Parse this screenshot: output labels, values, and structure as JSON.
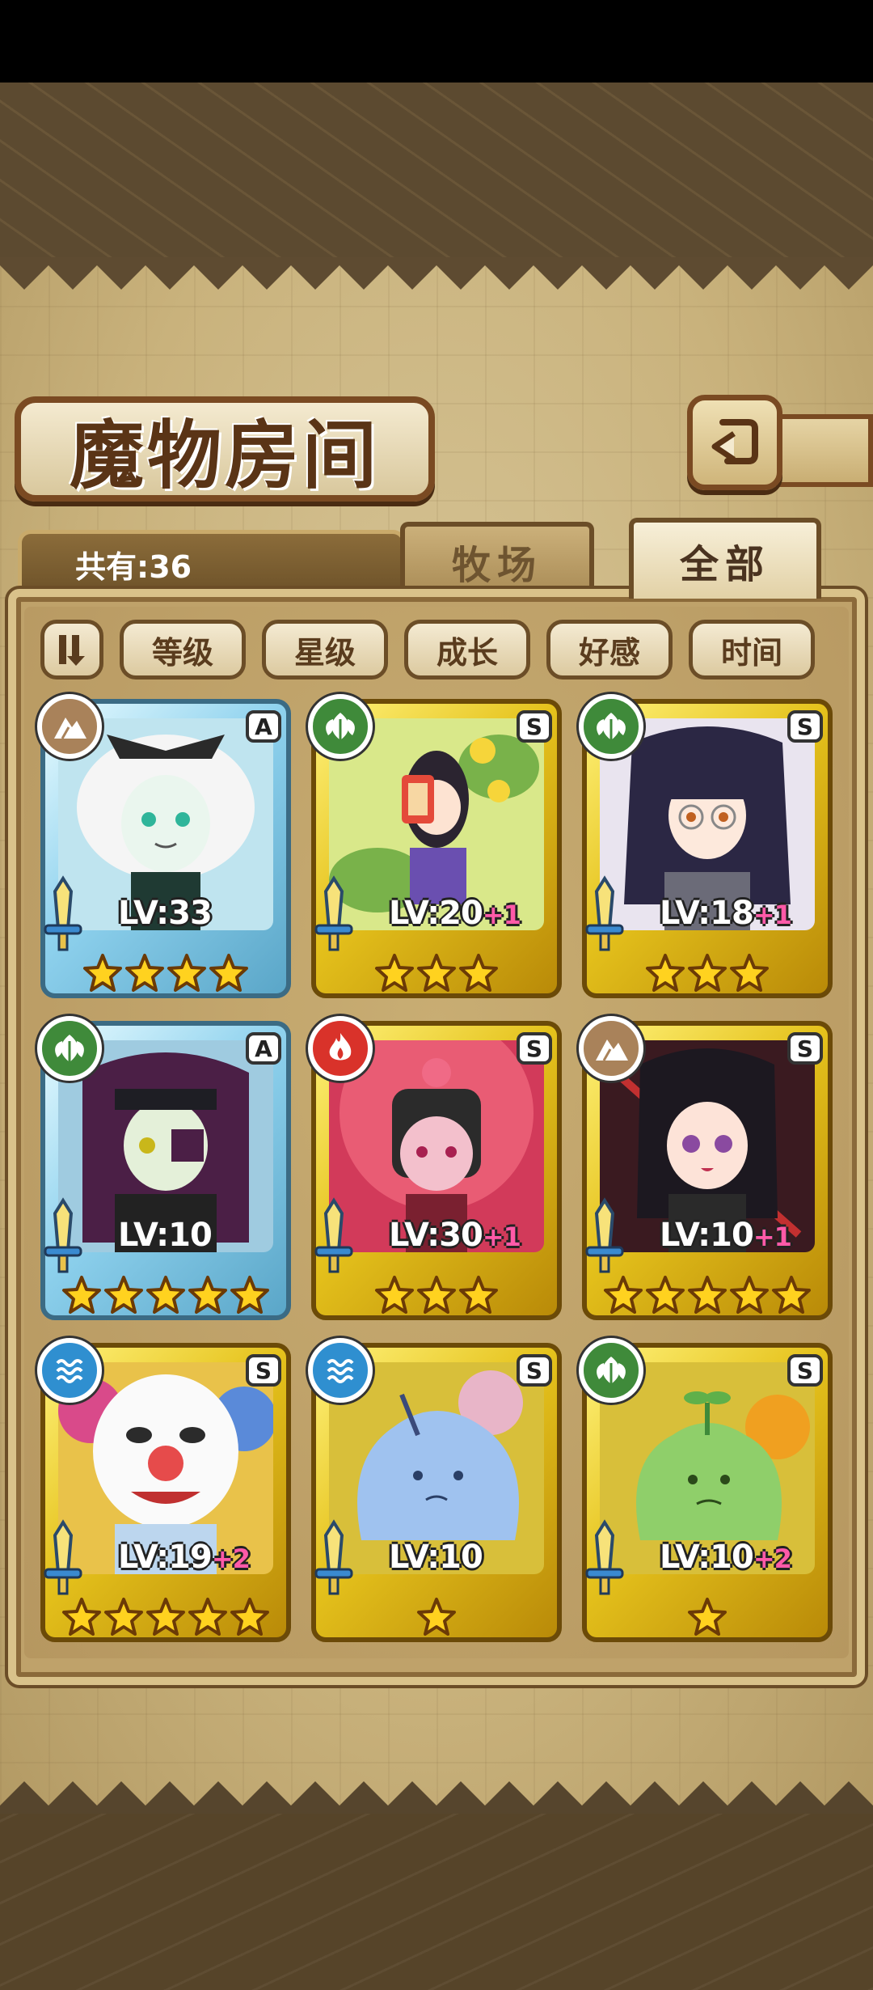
{
  "title": "魔物房间",
  "count_label": "共有:36",
  "tabs": [
    {
      "label": "牧场",
      "active": false
    },
    {
      "label": "全部",
      "active": true
    }
  ],
  "sort_buttons": [
    "等级",
    "星级",
    "成长",
    "好感",
    "时间"
  ],
  "colors": {
    "earth": "#a9825a",
    "wood": "#3f8a3a",
    "fire": "#d9322a",
    "water": "#2f8fd0",
    "gold_frame": "#e5c21c",
    "silver_frame": "#8fd2ee",
    "plus_level": "#ff5aa8"
  },
  "monsters": [
    {
      "element": "earth",
      "rank": "A",
      "frame": "silver",
      "level": "LV:33",
      "plus": "",
      "stars": 4,
      "portrait": "white-haired-girl"
    },
    {
      "element": "wood",
      "rank": "S",
      "frame": "gold",
      "level": "LV:20",
      "plus": "+1",
      "stars": 3,
      "portrait": "flower-talisman-girl"
    },
    {
      "element": "wood",
      "rank": "S",
      "frame": "gold",
      "level": "LV:18",
      "plus": "+1",
      "stars": 3,
      "portrait": "glasses-girl"
    },
    {
      "element": "wood",
      "rank": "A",
      "frame": "silver",
      "level": "LV:10",
      "plus": "",
      "stars": 5,
      "portrait": "masked-purple-hair-girl"
    },
    {
      "element": "fire",
      "rank": "S",
      "frame": "gold",
      "level": "LV:30",
      "plus": "+1",
      "stars": 3,
      "portrait": "flower-bob-girl"
    },
    {
      "element": "earth",
      "rank": "S",
      "frame": "gold",
      "level": "LV:10",
      "plus": "+1",
      "stars": 5,
      "portrait": "black-hair-girl"
    },
    {
      "element": "water",
      "rank": "S",
      "frame": "gold",
      "level": "LV:19",
      "plus": "+2",
      "stars": 5,
      "portrait": "clown"
    },
    {
      "element": "water",
      "rank": "S",
      "frame": "gold",
      "level": "LV:10",
      "plus": "",
      "stars": 1,
      "portrait": "blue-slime"
    },
    {
      "element": "wood",
      "rank": "S",
      "frame": "gold",
      "level": "LV:10",
      "plus": "+2",
      "stars": 1,
      "portrait": "green-slime"
    }
  ]
}
